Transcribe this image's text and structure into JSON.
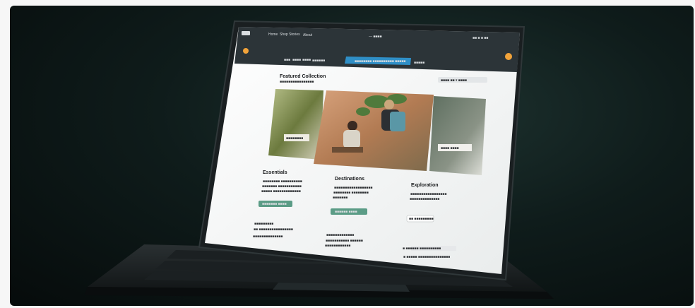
{
  "scene": {
    "description_colors": {
      "background": "#0f1c1b",
      "screen_header": "#2c3438",
      "accent_blue": "#2f8fc7",
      "accent_orange": "#f2a33a",
      "accent_green": "#5b9c86"
    }
  },
  "website": {
    "nav": {
      "logo": "■■",
      "links": [
        "Home",
        "Shop  Stories",
        "About"
      ],
      "center": "— ■■■■",
      "right_icons": [
        "■■",
        "■",
        "■",
        "■■"
      ]
    },
    "search": {
      "placeholder": "■■■■■■■■ ■■■■■■■■■■ ■■■■■"
    },
    "filters": [
      "■■■",
      "■■■■",
      "■■■■",
      "■■■■■■",
      "■■■■■"
    ],
    "section_title": "Featured Collection",
    "section_subtitle": "■■■■■■■■■■■■■■■■",
    "sort_label": "■■■■  ■■  ▾ ■■■■",
    "cards": [
      {
        "title": "Essentials",
        "text_lines": [
          "■■■■■■■■ ■■■■■■■■■■",
          "■■■■■■■ ■■■■■■■■■■■",
          "■■■■■ ■■■■■■■■■■■■■"
        ],
        "button": "■■■■■■■ ■■■■"
      },
      {
        "title": "Destinations",
        "text_lines": [
          "■■■■■■■■■■■■■■■■■■",
          "■■■■■■■■ ■■■■■■■■",
          "■■■■■■■"
        ],
        "button": "■■■■■■ ■■■■"
      },
      {
        "title": "Exploration",
        "text_lines": [
          "■■■■■■■■■■■■■■■■■",
          "■■■■■■■■■■■■■■"
        ],
        "button": "■■ ■■■■■■■■■"
      }
    ],
    "image_captions": [
      "■■■■■■■■",
      "■■■■ ■■■■"
    ],
    "footer_left": [
      "■■■■■■■■■",
      "■■ ■■■■■■■■■■■■■■■■",
      "■■■■■■■■■■■■■■"
    ],
    "footer_middle": [
      "■■■■■■■■■■■■■",
      "■■■■■■■■■■■ ■■■■■■",
      "■■■■■■■■■■■■"
    ],
    "footer_right": [
      "■ ■■■■■■ ■■■■■■■■■■",
      "■ ■■■■■ ■■■■■■■■■■■■■■■"
    ]
  }
}
